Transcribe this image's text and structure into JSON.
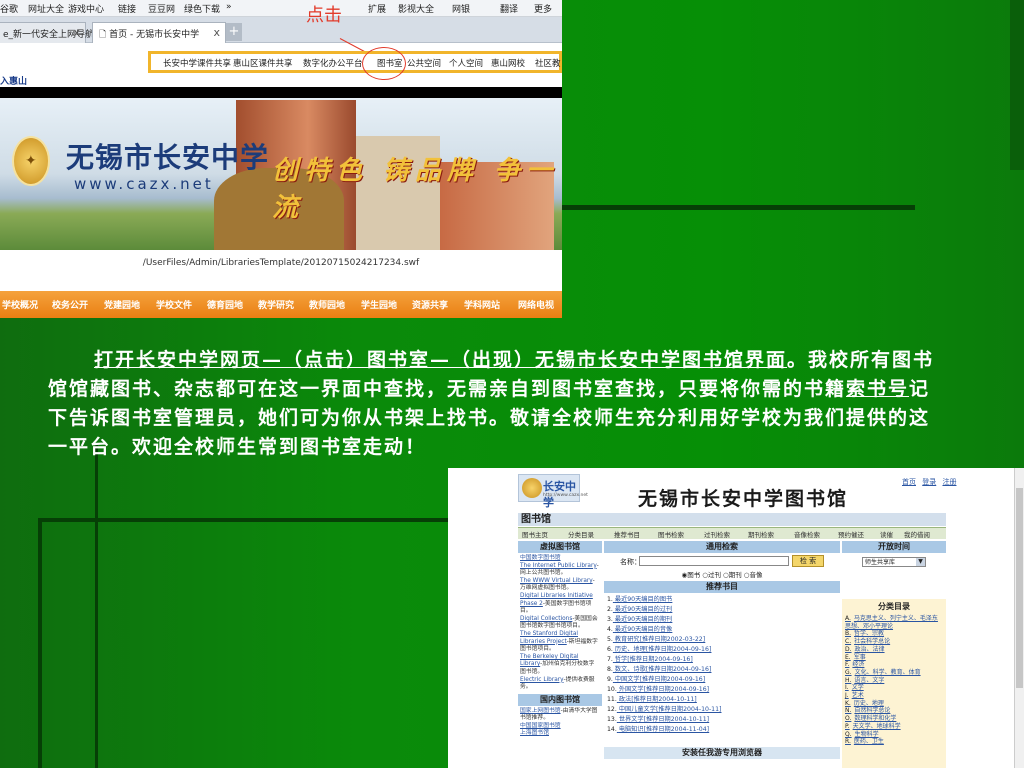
{
  "shot1": {
    "favorites": [
      "谷歌",
      "网址大全",
      "游戏中心",
      "链接",
      "豆豆网",
      "绿色下载",
      "»",
      "扩展",
      "影视大全",
      "网银",
      "翻译",
      "更多"
    ],
    "tabs": [
      {
        "label": "e_新一代安全上网导航",
        "close": "x"
      },
      {
        "label": "首页 - 无锡市长安中学",
        "close": "x"
      }
    ],
    "new_tab": "+",
    "annotation": "点击",
    "nav": [
      "长安中学课件共享",
      "惠山区课件共享",
      "数字化办公平台",
      "图书室",
      "公共空间",
      "个人空间",
      "惠山网校",
      "社区教"
    ],
    "highlighted_nav": "图书室",
    "logo_link": "入惠山",
    "school_name": "无锡市长安中学",
    "school_url": "www.cazx.net",
    "slogan": "创特色 铸品牌 争一流",
    "swf_path": "/UserFiles/Admin/LibrariesTemplate/20120715024217234.swf",
    "bottom_nav": [
      "学校概况",
      "校务公开",
      "党建园地",
      "学校文件",
      "德育园地",
      "教学研究",
      "教师园地",
      "学生园地",
      "资源共享",
      "学科网站",
      "网络电视"
    ]
  },
  "paragraph": {
    "part1": "打开长安中学网页—（点击）图书室—（出现）无锡市长安中学图书馆界面",
    "part2": "。我校所有图书馆馆藏图书、杂志都可在这一界面中查找，无需亲自到图书室查找，只要将你需的书籍",
    "part3": "索书号",
    "part4": "记下告诉图书室管理员，她们可为你从书架上找书。敬请全校师生充分利用好学校为我们提供的这一平台。欢迎全校师生常到图书室走动！"
  },
  "shot2": {
    "logo_text": "长安中学",
    "logo_url": "http://www.cazx.net",
    "title": "无锡市长安中学图书馆",
    "top_links": [
      "首页",
      "登录",
      "注册"
    ],
    "section": "图书馆",
    "nav": [
      "图书主页",
      "分类目录",
      "推荐书目",
      "图书检索",
      "过刊检索",
      "期刊检索",
      "音像检索",
      "预约催还",
      "读催",
      "我的借阅"
    ],
    "left_head": "虚拟图书馆",
    "left_items": [
      {
        "link": "中国数字图书馆",
        "desc": ""
      },
      {
        "link": "The Internet Public Library",
        "desc": "-网上公共图书馆。"
      },
      {
        "link": "The WWW Virtual Library",
        "desc": "-万维网虚拟图书馆。"
      },
      {
        "link": "Digital Libraries Initiative Phase 2",
        "desc": "-美国数字图书馆项目。"
      },
      {
        "link": "Digital Collections",
        "desc": "-美国国会图书馆数字图书馆项目。"
      },
      {
        "link": "The Stanford Digital Libraries Project",
        "desc": "-斯坦福数字图书馆项目。"
      },
      {
        "link": "The Berkeley Digital Library",
        "desc": "-加州伯克利分校数字图书馆。"
      },
      {
        "link": "Electric Library",
        "desc": "-提供收费服务。"
      }
    ],
    "left_head2": "国内图书馆",
    "left_items2": [
      {
        "link": "国家上网图书馆",
        "desc": "-由清华大学图书馆推荐。"
      },
      {
        "link": "中国国家图书馆",
        "desc": ""
      },
      {
        "link": "上海图书馆",
        "desc": ""
      }
    ],
    "search_head": "通用检索",
    "search_label": "名称：",
    "search_button": "检 索",
    "radios": [
      "图书",
      "过刊",
      "期刊",
      "音像"
    ],
    "recommend_head": "推荐书目",
    "recommend": [
      {
        "n": "1.",
        "t": "最近90天编目的图书",
        "d": ""
      },
      {
        "n": "2.",
        "t": "最近90天编目的过刊",
        "d": ""
      },
      {
        "n": "3.",
        "t": "最近90天编目的期刊",
        "d": ""
      },
      {
        "n": "4.",
        "t": "最近90天编目的音像",
        "d": ""
      },
      {
        "n": "5.",
        "t": "教育研究",
        "d": "[推荐日期2002-03-22]"
      },
      {
        "n": "6.",
        "t": "历史、地理",
        "d": "[推荐日期2004-09-16]"
      },
      {
        "n": "7.",
        "t": "哲学",
        "d": "[推荐日期2004-09-16]"
      },
      {
        "n": "8.",
        "t": "数文、诗歌",
        "d": "[推荐日期2004-09-16]"
      },
      {
        "n": "9.",
        "t": "中国文学",
        "d": "[推荐日期2004-09-16]"
      },
      {
        "n": "10.",
        "t": "外国文学",
        "d": "[推荐日期2004-09-16]"
      },
      {
        "n": "11.",
        "t": "政法",
        "d": "[推荐日期2004-10-11]"
      },
      {
        "n": "12.",
        "t": "中国儿童文学",
        "d": "[推荐日期2004-10-11]"
      },
      {
        "n": "13.",
        "t": "世界文学",
        "d": "[推荐日期2004-10-11]"
      },
      {
        "n": "14.",
        "t": "电脑知识",
        "d": "[推荐日期2004-11-04]"
      }
    ],
    "browser_head": "安装任我游专用浏览器",
    "open_head": "开放时间",
    "open_select": "师生共享库",
    "cat_head": "分类目录",
    "categories": [
      {
        "k": "A.",
        "v": "马克思主义、列宁主义、毛泽东思想、邓小平理论"
      },
      {
        "k": "B.",
        "v": "哲学、宗教"
      },
      {
        "k": "C.",
        "v": "社会科学总论"
      },
      {
        "k": "D.",
        "v": "政治、法律"
      },
      {
        "k": "E.",
        "v": "军事"
      },
      {
        "k": "F.",
        "v": "经济"
      },
      {
        "k": "G.",
        "v": "文化、科学、教育、体育"
      },
      {
        "k": "H.",
        "v": "语言、文字"
      },
      {
        "k": "I.",
        "v": "文学"
      },
      {
        "k": "J.",
        "v": "艺术"
      },
      {
        "k": "K.",
        "v": "历史、地理"
      },
      {
        "k": "N.",
        "v": "自然科学总论"
      },
      {
        "k": "O.",
        "v": "数理科学和化学"
      },
      {
        "k": "P.",
        "v": "天文学、地球科学"
      },
      {
        "k": "Q.",
        "v": "生物科学"
      },
      {
        "k": "R.",
        "v": "医药、卫生"
      }
    ]
  }
}
